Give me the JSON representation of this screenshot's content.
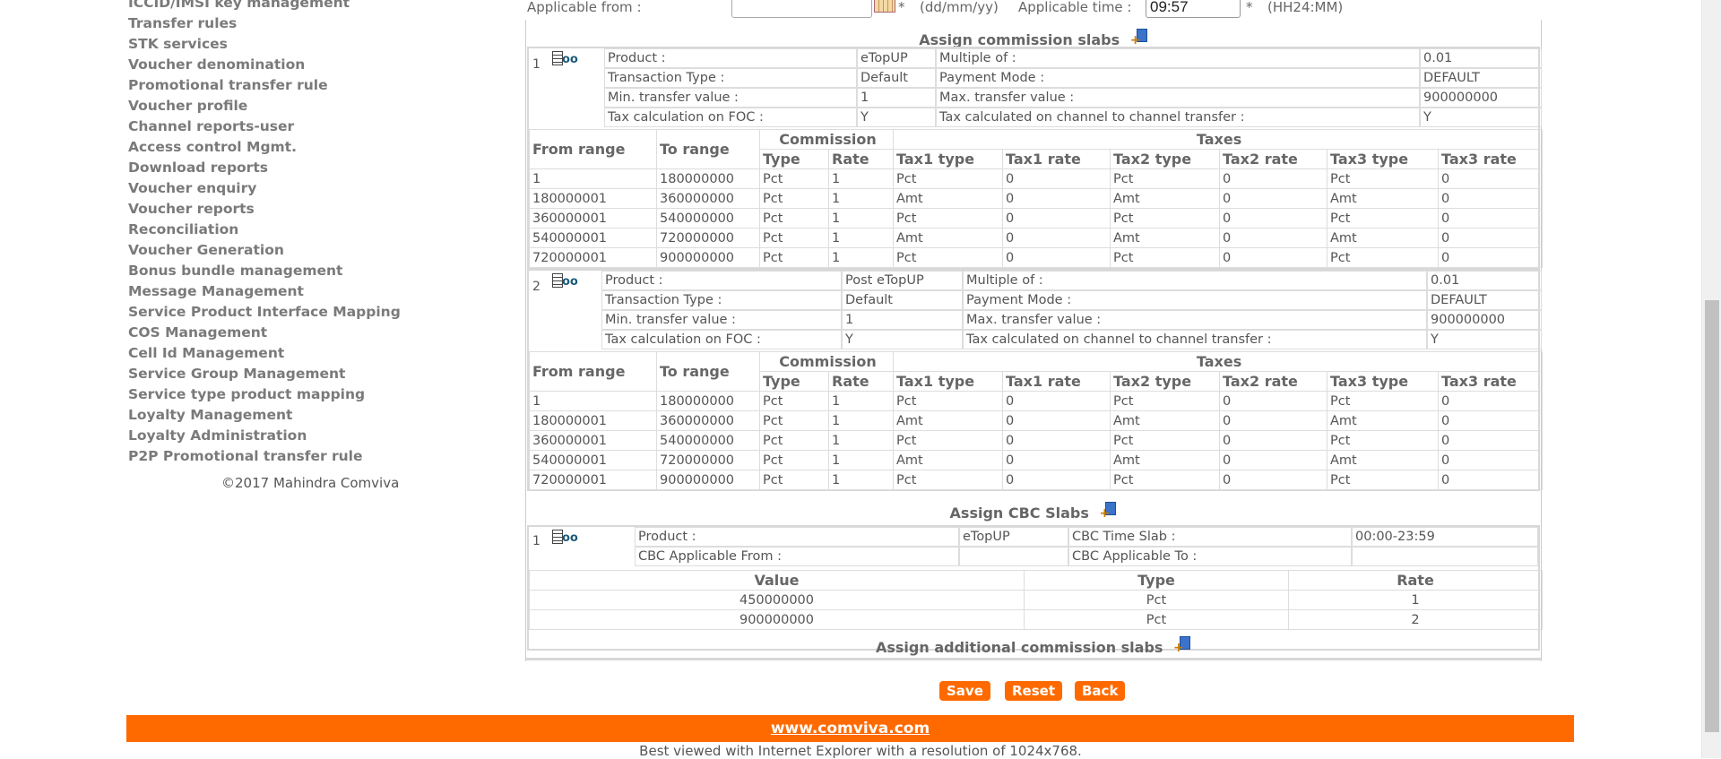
{
  "sidebar": {
    "items": [
      "ICCID/IMSI key management",
      "Transfer rules",
      "STK services",
      "Voucher denomination",
      "Promotional transfer rule",
      "Voucher profile",
      "Channel reports-user",
      "Access control Mgmt.",
      "Download reports",
      "Voucher enquiry",
      "Voucher reports",
      "Reconciliation",
      "Voucher Generation",
      "Bonus bundle management",
      "Message Management",
      "Service Product Interface Mapping",
      "COS Management",
      "Cell Id Management",
      "Service Group Management",
      "Service type product mapping",
      "Loyalty Management",
      "Loyalty Administration",
      "P2P Promotional transfer rule"
    ],
    "copyright": "©2017 Mahindra Comviva"
  },
  "applicable": {
    "from_label": "Applicable from :",
    "date_value": "",
    "star1": "*",
    "date_format": "(dd/mm/yy)",
    "time_label": "Applicable time :",
    "time_value": "09:57",
    "star2": "*",
    "time_format": "(HH24:MM)"
  },
  "sections": {
    "commission_title": "Assign commission slabs",
    "cbc_title": "Assign CBC Slabs",
    "additional_title": "Assign additional commission slabs"
  },
  "slab_headers": {
    "from_range": "From range",
    "to_range": "To range",
    "commission": "Commission",
    "taxes": "Taxes",
    "type": "Type",
    "rate": "Rate",
    "tax1_type": "Tax1 type",
    "tax1_rate": "Tax1 rate",
    "tax2_type": "Tax2 type",
    "tax2_rate": "Tax2 rate",
    "tax3_type": "Tax3 type",
    "tax3_rate": "Tax3 rate"
  },
  "labels": {
    "product": "Product :",
    "multiple_of": "Multiple of :",
    "transaction_type": "Transaction Type :",
    "payment_mode": "Payment Mode :",
    "min_transfer": "Min. transfer value :",
    "max_transfer": "Max. transfer value :",
    "tax_foc": "Tax calculation on FOC :",
    "tax_c2c": "Tax calculated on channel to channel transfer :"
  },
  "commission_slabs": [
    {
      "index": "1",
      "product": "eTopUP",
      "multiple_of": "0.01",
      "transaction_type": "Default",
      "payment_mode": "DEFAULT",
      "min_transfer": "1",
      "max_transfer": "900000000",
      "tax_foc": "Y",
      "tax_c2c": "Y",
      "rows": [
        [
          "1",
          "180000000",
          "Pct",
          "1",
          "Pct",
          "0",
          "Pct",
          "0",
          "Pct",
          "0"
        ],
        [
          "180000001",
          "360000000",
          "Pct",
          "1",
          "Amt",
          "0",
          "Amt",
          "0",
          "Amt",
          "0"
        ],
        [
          "360000001",
          "540000000",
          "Pct",
          "1",
          "Pct",
          "0",
          "Pct",
          "0",
          "Pct",
          "0"
        ],
        [
          "540000001",
          "720000000",
          "Pct",
          "1",
          "Amt",
          "0",
          "Amt",
          "0",
          "Amt",
          "0"
        ],
        [
          "720000001",
          "900000000",
          "Pct",
          "1",
          "Pct",
          "0",
          "Pct",
          "0",
          "Pct",
          "0"
        ]
      ]
    },
    {
      "index": "2",
      "product": "Post eTopUP",
      "multiple_of": "0.01",
      "transaction_type": "Default",
      "payment_mode": "DEFAULT",
      "min_transfer": "1",
      "max_transfer": "900000000",
      "tax_foc": "Y",
      "tax_c2c": "Y",
      "rows": [
        [
          "1",
          "180000000",
          "Pct",
          "1",
          "Pct",
          "0",
          "Pct",
          "0",
          "Pct",
          "0"
        ],
        [
          "180000001",
          "360000000",
          "Pct",
          "1",
          "Amt",
          "0",
          "Amt",
          "0",
          "Amt",
          "0"
        ],
        [
          "360000001",
          "540000000",
          "Pct",
          "1",
          "Pct",
          "0",
          "Pct",
          "0",
          "Pct",
          "0"
        ],
        [
          "540000001",
          "720000000",
          "Pct",
          "1",
          "Amt",
          "0",
          "Amt",
          "0",
          "Amt",
          "0"
        ],
        [
          "720000001",
          "900000000",
          "Pct",
          "1",
          "Pct",
          "0",
          "Pct",
          "0",
          "Pct",
          "0"
        ]
      ]
    }
  ],
  "cbc": {
    "index": "1",
    "product_label": "Product :",
    "product": "eTopUP",
    "time_slab_label": "CBC Time Slab :",
    "time_slab": "00:00-23:59",
    "from_label": "CBC Applicable From :",
    "from_value": "",
    "to_label": "CBC Applicable To :",
    "to_value": "",
    "headers": [
      "Value",
      "Type",
      "Rate"
    ],
    "rows": [
      [
        "450000000",
        "Pct",
        "1"
      ],
      [
        "900000000",
        "Pct",
        "2"
      ]
    ]
  },
  "buttons": {
    "save": "Save",
    "reset": "Reset",
    "back": "Back"
  },
  "footer": {
    "link": "www.comviva.com",
    "note": "Best viewed with Internet Explorer with a resolution of 1024x768."
  },
  "colors": {
    "accent": "#ff6a00",
    "menu_text": "#7a7a7a"
  }
}
